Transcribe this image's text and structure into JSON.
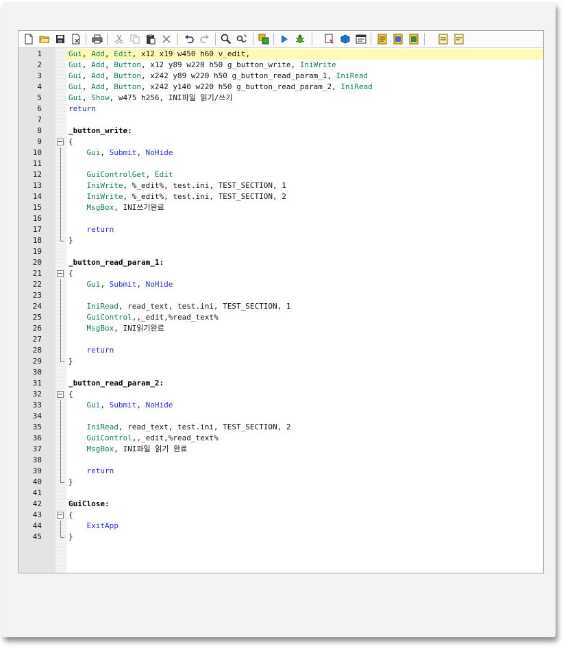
{
  "toolbar": {
    "buttons": [
      "new-file-icon",
      "open-folder-icon",
      "save-icon",
      "close-file-icon",
      "print-icon",
      "cut-icon",
      "copy-icon",
      "paste-icon",
      "delete-icon",
      "undo-icon",
      "redo-icon",
      "find-icon",
      "replace-icon",
      "compile-icon",
      "run-icon",
      "debug-icon",
      "tool1-icon",
      "tool2-icon",
      "tool3-icon",
      "doc1-icon",
      "doc2-icon",
      "doc3-icon",
      "doc4-icon",
      "doc5-icon"
    ]
  },
  "colors": {
    "keyword": "#117a5b",
    "builtin": "#2a2ad6",
    "label": "#000000",
    "text": "#111111",
    "current_line": "#fffbb6"
  },
  "editor": {
    "lines": [
      {
        "n": "1",
        "tokens": [
          [
            "k",
            "Gui"
          ],
          [
            "t",
            ", "
          ],
          [
            "k",
            "Add"
          ],
          [
            "t",
            ", "
          ],
          [
            "k",
            "Edit"
          ],
          [
            "t",
            ", x12 x19 w450 h60 v_edit,"
          ]
        ]
      },
      {
        "n": "2",
        "tokens": [
          [
            "k",
            "Gui"
          ],
          [
            "t",
            ", "
          ],
          [
            "k",
            "Add"
          ],
          [
            "t",
            ", "
          ],
          [
            "k",
            "Button"
          ],
          [
            "t",
            ", x12 y89 w220 h50 g_button_write, "
          ],
          [
            "k",
            "IniWrite"
          ]
        ]
      },
      {
        "n": "3",
        "tokens": [
          [
            "k",
            "Gui"
          ],
          [
            "t",
            ", "
          ],
          [
            "k",
            "Add"
          ],
          [
            "t",
            ", "
          ],
          [
            "k",
            "Button"
          ],
          [
            "t",
            ", x242 y89 w220 h50 g_button_read_param_1, "
          ],
          [
            "k",
            "IniRead"
          ]
        ]
      },
      {
        "n": "4",
        "tokens": [
          [
            "k",
            "Gui"
          ],
          [
            "t",
            ", "
          ],
          [
            "k",
            "Add"
          ],
          [
            "t",
            ", "
          ],
          [
            "k",
            "Button"
          ],
          [
            "t",
            ", x242 y140 w220 h50 g_button_read_param_2, "
          ],
          [
            "k",
            "IniRead"
          ]
        ]
      },
      {
        "n": "5",
        "tokens": [
          [
            "k",
            "Gui"
          ],
          [
            "t",
            ", "
          ],
          [
            "k",
            "Show"
          ],
          [
            "t",
            ", w475 h256, INI파일 읽기/쓰기"
          ]
        ]
      },
      {
        "n": "6",
        "tokens": [
          [
            "b",
            "return"
          ]
        ]
      },
      {
        "n": "7",
        "tokens": []
      },
      {
        "n": "8",
        "tokens": [
          [
            "l",
            "_button_write:"
          ]
        ]
      },
      {
        "n": "9",
        "fold": "open",
        "tokens": [
          [
            "t",
            "{"
          ]
        ]
      },
      {
        "n": "10",
        "fold": "mid",
        "tokens": [
          [
            "t",
            "    "
          ],
          [
            "k",
            "Gui"
          ],
          [
            "t",
            ", "
          ],
          [
            "b",
            "Submit"
          ],
          [
            "t",
            ", "
          ],
          [
            "b",
            "NoHide"
          ]
        ]
      },
      {
        "n": "11",
        "fold": "mid",
        "tokens": []
      },
      {
        "n": "12",
        "fold": "mid",
        "tokens": [
          [
            "t",
            "    "
          ],
          [
            "k",
            "GuiControlGet"
          ],
          [
            "t",
            ", "
          ],
          [
            "k",
            "Edit"
          ]
        ]
      },
      {
        "n": "13",
        "fold": "mid",
        "tokens": [
          [
            "t",
            "    "
          ],
          [
            "k",
            "IniWrite"
          ],
          [
            "t",
            ", %_edit%, test.ini, TEST_SECTION, 1"
          ]
        ]
      },
      {
        "n": "14",
        "fold": "mid",
        "tokens": [
          [
            "t",
            "    "
          ],
          [
            "k",
            "IniWrite"
          ],
          [
            "t",
            ", %_edit%, test.ini, TEST_SECTION, 2"
          ]
        ]
      },
      {
        "n": "15",
        "fold": "mid",
        "tokens": [
          [
            "t",
            "    "
          ],
          [
            "k",
            "MsgBox"
          ],
          [
            "t",
            ", INI쓰기완료"
          ]
        ]
      },
      {
        "n": "16",
        "fold": "mid",
        "tokens": []
      },
      {
        "n": "17",
        "fold": "mid",
        "tokens": [
          [
            "t",
            "    "
          ],
          [
            "b",
            "return"
          ]
        ]
      },
      {
        "n": "18",
        "fold": "end",
        "tokens": [
          [
            "t",
            "}"
          ]
        ]
      },
      {
        "n": "19",
        "tokens": []
      },
      {
        "n": "20",
        "tokens": [
          [
            "l",
            "_button_read_param_1:"
          ]
        ]
      },
      {
        "n": "21",
        "fold": "open",
        "tokens": [
          [
            "t",
            "{"
          ]
        ]
      },
      {
        "n": "22",
        "fold": "mid",
        "tokens": [
          [
            "t",
            "    "
          ],
          [
            "k",
            "Gui"
          ],
          [
            "t",
            ", "
          ],
          [
            "b",
            "Submit"
          ],
          [
            "t",
            ", "
          ],
          [
            "b",
            "NoHide"
          ]
        ]
      },
      {
        "n": "23",
        "fold": "mid",
        "tokens": []
      },
      {
        "n": "24",
        "fold": "mid",
        "tokens": [
          [
            "t",
            "    "
          ],
          [
            "k",
            "IniRead"
          ],
          [
            "t",
            ", read_text, test.ini, TEST_SECTION, 1"
          ]
        ]
      },
      {
        "n": "25",
        "fold": "mid",
        "tokens": [
          [
            "t",
            "    "
          ],
          [
            "k",
            "GuiControl"
          ],
          [
            "t",
            ",,_edit,%read_text%"
          ]
        ]
      },
      {
        "n": "26",
        "fold": "mid",
        "tokens": [
          [
            "t",
            "    "
          ],
          [
            "k",
            "MsgBox"
          ],
          [
            "t",
            ", INI읽기완료"
          ]
        ]
      },
      {
        "n": "27",
        "fold": "mid",
        "tokens": []
      },
      {
        "n": "28",
        "fold": "mid",
        "tokens": [
          [
            "t",
            "    "
          ],
          [
            "b",
            "return"
          ]
        ]
      },
      {
        "n": "29",
        "fold": "end",
        "tokens": [
          [
            "t",
            "}"
          ]
        ]
      },
      {
        "n": "30",
        "tokens": []
      },
      {
        "n": "31",
        "tokens": [
          [
            "l",
            "_button_read_param_2:"
          ]
        ]
      },
      {
        "n": "32",
        "fold": "open",
        "tokens": [
          [
            "t",
            "{"
          ]
        ]
      },
      {
        "n": "33",
        "fold": "mid",
        "tokens": [
          [
            "t",
            "    "
          ],
          [
            "k",
            "Gui"
          ],
          [
            "t",
            ", "
          ],
          [
            "b",
            "Submit"
          ],
          [
            "t",
            ", "
          ],
          [
            "b",
            "NoHide"
          ]
        ]
      },
      {
        "n": "34",
        "fold": "mid",
        "tokens": []
      },
      {
        "n": "35",
        "fold": "mid",
        "tokens": [
          [
            "t",
            "    "
          ],
          [
            "k",
            "IniRead"
          ],
          [
            "t",
            ", read_text, test.ini, TEST_SECTION, 2"
          ]
        ]
      },
      {
        "n": "36",
        "fold": "mid",
        "tokens": [
          [
            "t",
            "    "
          ],
          [
            "k",
            "GuiControl"
          ],
          [
            "t",
            ",,_edit,%read_text%"
          ]
        ]
      },
      {
        "n": "37",
        "fold": "mid",
        "tokens": [
          [
            "t",
            "    "
          ],
          [
            "k",
            "MsgBox"
          ],
          [
            "t",
            ", INI파일 읽기 완료"
          ]
        ]
      },
      {
        "n": "38",
        "fold": "mid",
        "tokens": []
      },
      {
        "n": "39",
        "fold": "mid",
        "tokens": [
          [
            "t",
            "    "
          ],
          [
            "b",
            "return"
          ]
        ]
      },
      {
        "n": "40",
        "fold": "end",
        "tokens": [
          [
            "t",
            "}"
          ]
        ]
      },
      {
        "n": "41",
        "tokens": []
      },
      {
        "n": "42",
        "tokens": [
          [
            "l",
            "GuiClose:"
          ]
        ]
      },
      {
        "n": "43",
        "fold": "open",
        "tokens": [
          [
            "t",
            "{"
          ]
        ]
      },
      {
        "n": "44",
        "fold": "mid",
        "tokens": [
          [
            "t",
            "    "
          ],
          [
            "b",
            "ExitApp"
          ]
        ]
      },
      {
        "n": "45",
        "fold": "end",
        "tokens": [
          [
            "t",
            "}"
          ]
        ]
      }
    ]
  }
}
